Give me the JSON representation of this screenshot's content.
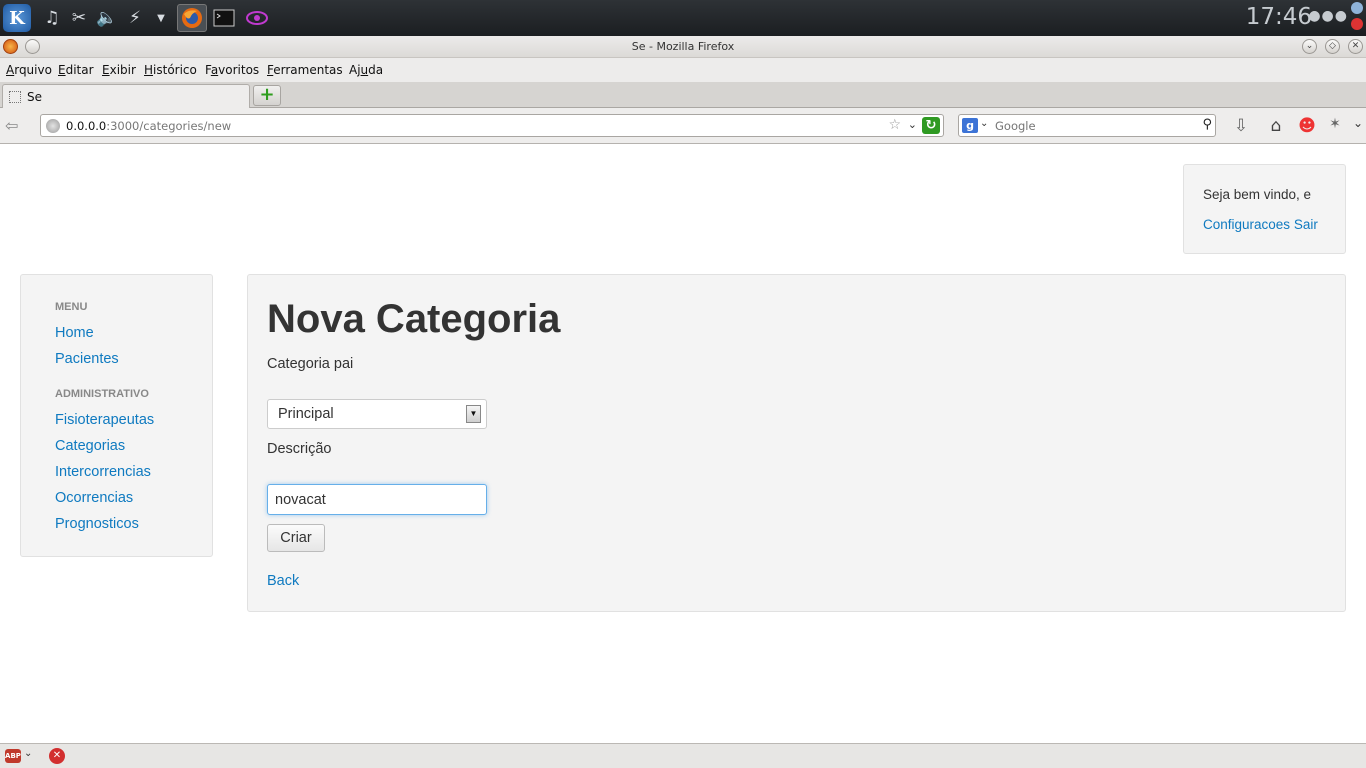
{
  "panel": {
    "launchers": [
      "kde-menu-icon",
      "music-icon",
      "tools-icon",
      "volume-icon",
      "network-icon",
      "chevron-down-icon"
    ],
    "tasks": [
      "firefox-icon",
      "terminal-icon",
      "eye-icon"
    ],
    "clock": "17:46",
    "dots": "●●●"
  },
  "window": {
    "title": "Se - Mozilla Firefox"
  },
  "menubar": {
    "items": [
      {
        "u": "A",
        "rest": "rquivo"
      },
      {
        "u": "E",
        "rest": "ditar"
      },
      {
        "u": "E",
        "rest": "xibir"
      },
      {
        "u": "H",
        "rest": "istórico"
      },
      {
        "pre": "F",
        "u": "a",
        "rest": "voritos"
      },
      {
        "u": "F",
        "rest": "erramentas"
      },
      {
        "pre": "Aj",
        "u": "u",
        "rest": "da"
      }
    ]
  },
  "tabs": {
    "active_label": "Se",
    "new_tab": "+"
  },
  "navbar": {
    "url_host": "0.0.0.0",
    "url_path": ":3000/categories/new",
    "search_placeholder": "Google",
    "search_engine": "g"
  },
  "header": {
    "welcome": "Seja bem vindo, e",
    "settings_link": "Configuracoes",
    "logout_link": "Sair"
  },
  "sidebar": {
    "menu_header": "MENU",
    "menu_items": [
      "Home",
      "Pacientes"
    ],
    "admin_header": "ADMINISTRATIVO",
    "admin_items": [
      "Fisioterapeutas",
      "Categorias",
      "Intercorrencias",
      "Ocorrencias",
      "Prognosticos"
    ]
  },
  "form": {
    "title": "Nova Categoria",
    "parent_label": "Categoria pai",
    "parent_value": "Principal",
    "description_label": "Descrição",
    "description_value": "novacat",
    "submit_label": "Criar",
    "back_link": "Back"
  },
  "statusbar": {
    "abp": "ABP"
  }
}
